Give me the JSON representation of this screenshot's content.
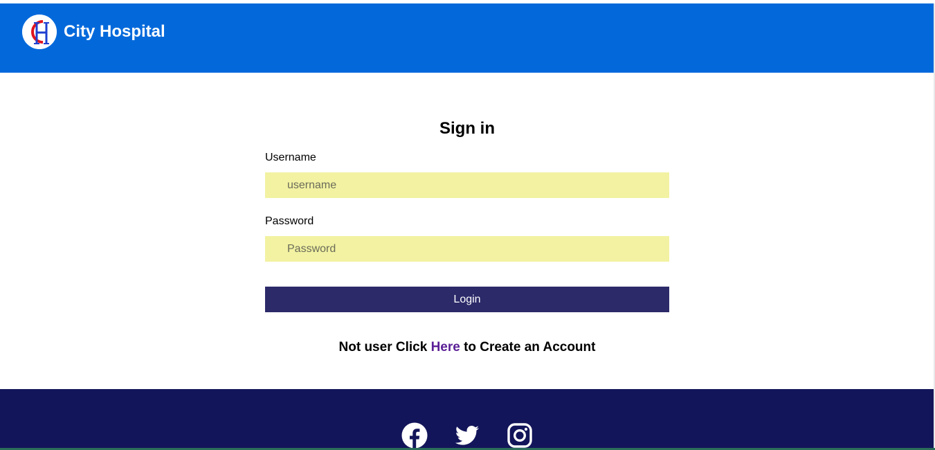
{
  "header": {
    "brand_name": "City Hospital",
    "logo_icon": "city-hospital-logo",
    "background_color": "#0369db"
  },
  "form": {
    "title": "Sign in",
    "username_label": "Username",
    "username_placeholder": "username",
    "username_value": "",
    "password_label": "Password",
    "password_placeholder": "Password",
    "password_value": "",
    "login_label": "Login",
    "field_color": "#f2f2a2",
    "button_color": "#2c2a69"
  },
  "signup": {
    "prefix": "Not user Click ",
    "link_text": "Here",
    "suffix": " to Create an Account",
    "link_color": "#5a1e96"
  },
  "footer": {
    "background_color": "#13155a",
    "icons": [
      "facebook-icon",
      "twitter-icon",
      "instagram-icon"
    ]
  }
}
